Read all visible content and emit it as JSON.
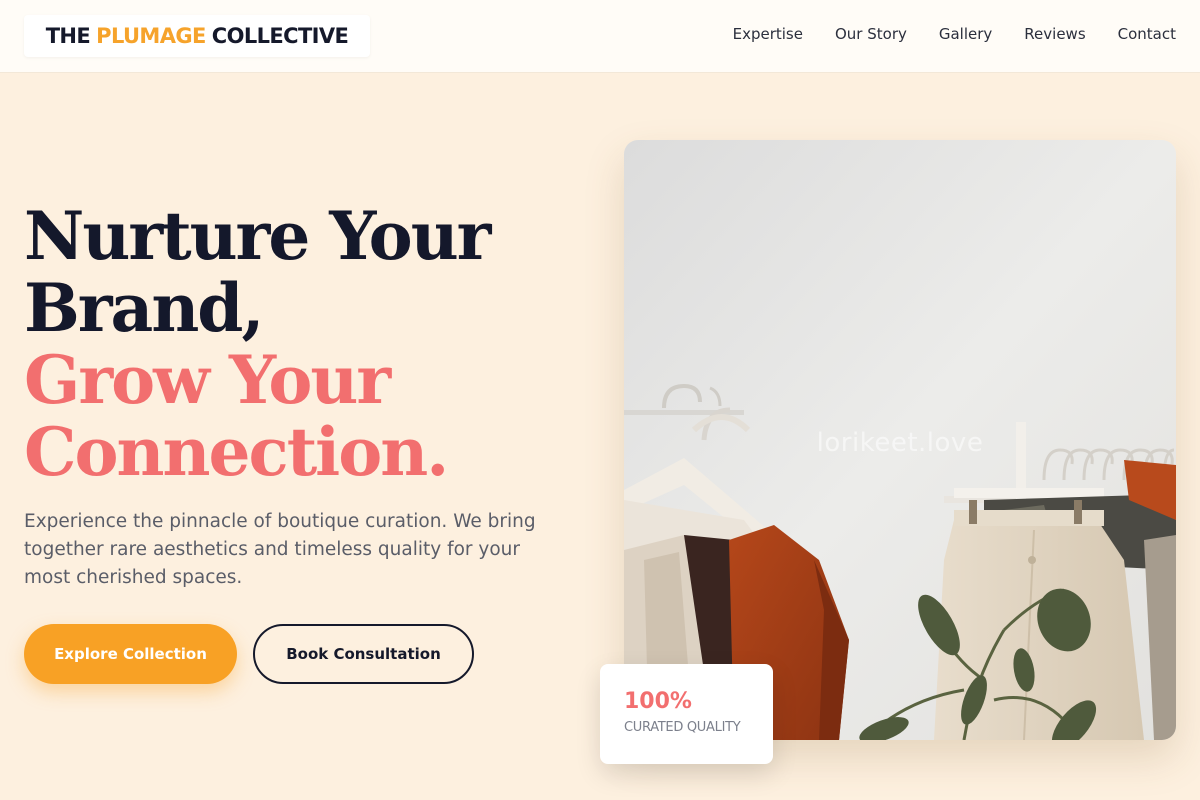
{
  "brand": {
    "part1": "THE",
    "part2": "PLUMAGE",
    "part3": "COLLECTIVE"
  },
  "nav": [
    {
      "label": "Expertise"
    },
    {
      "label": "Our Story"
    },
    {
      "label": "Gallery"
    },
    {
      "label": "Reviews"
    },
    {
      "label": "Contact"
    }
  ],
  "hero": {
    "line1": "Nurture Your",
    "line2": "Brand,",
    "line3": "Grow Your",
    "line4": "Connection.",
    "description": "Experience the pinnacle of boutique curation. We bring together rare aesthetics and timeless quality for your most cherished spaces.",
    "primary_button": "Explore Collection",
    "secondary_button": "Book Consultation"
  },
  "image": {
    "watermark": "lorikeet.love"
  },
  "stat": {
    "value": "100%",
    "label": "CURATED QUALITY"
  },
  "colors": {
    "accent": "#f8a125",
    "coral": "#f26f6f",
    "dark": "#15192b",
    "background": "#fdf0df"
  }
}
